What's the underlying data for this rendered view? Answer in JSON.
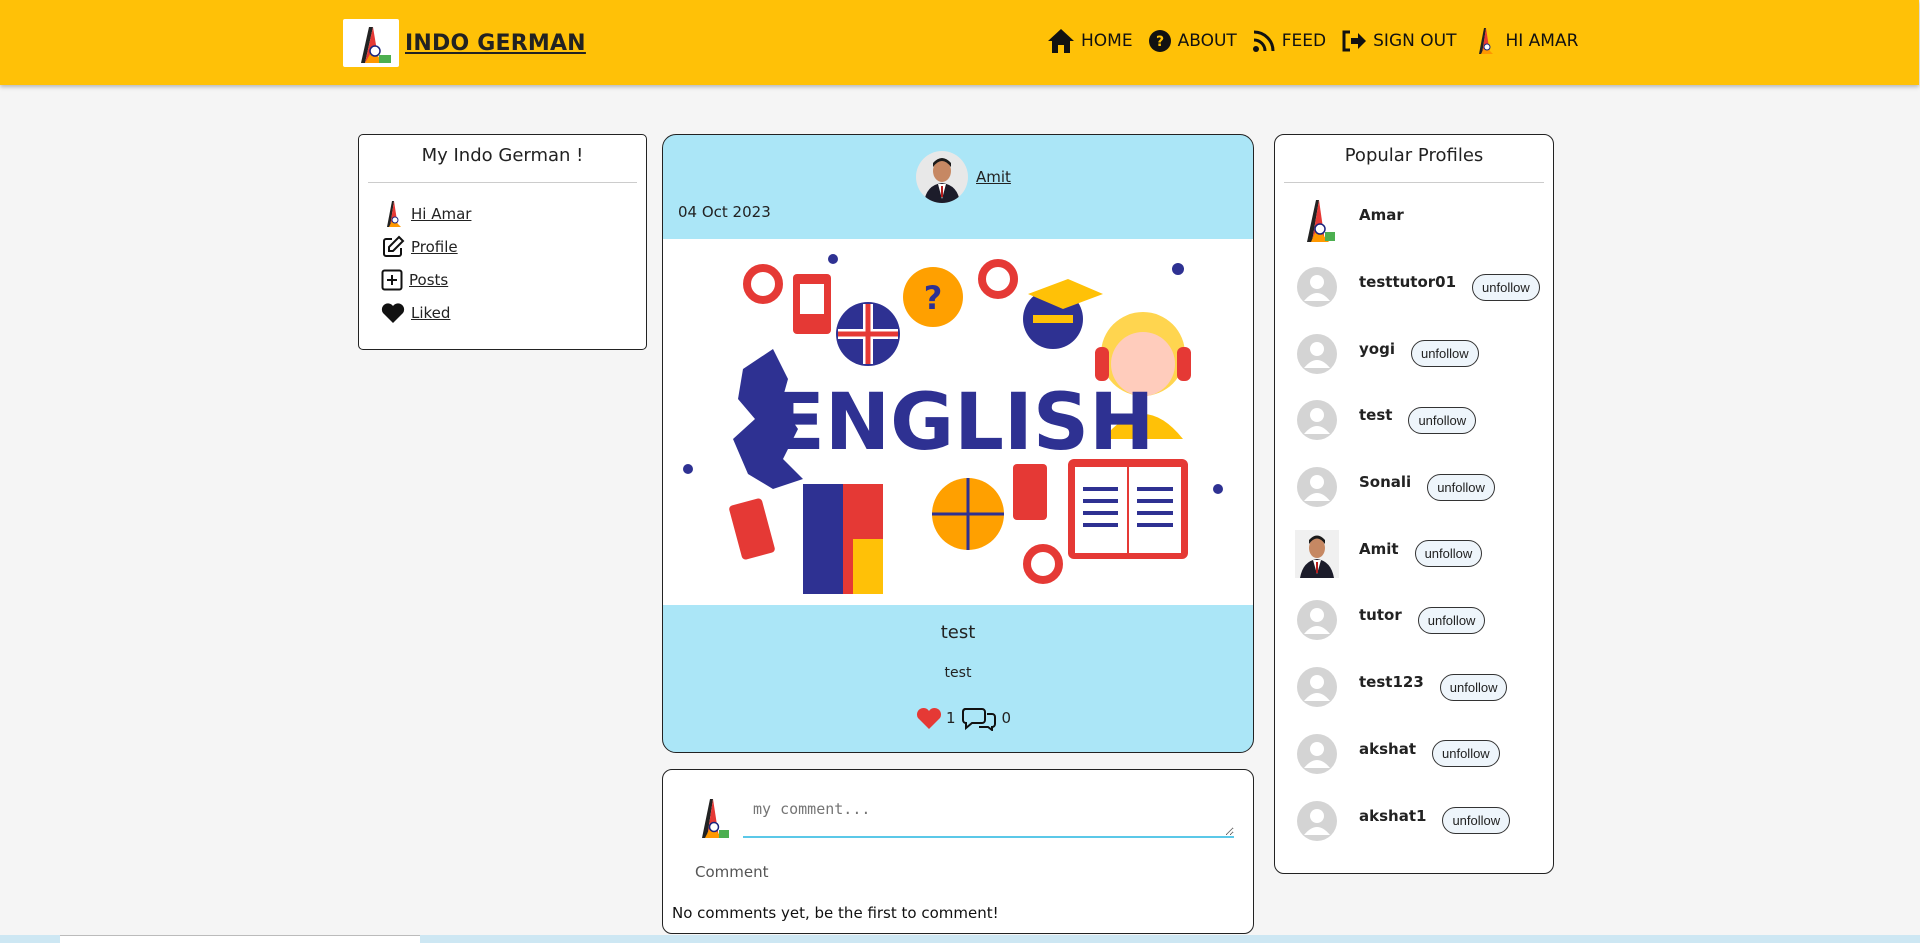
{
  "navbar": {
    "brand": "INDO GERMAN",
    "items": [
      {
        "label": "HOME",
        "icon": "home-icon"
      },
      {
        "label": "ABOUT",
        "icon": "question-icon"
      },
      {
        "label": "FEED",
        "icon": "rss-icon"
      },
      {
        "label": "SIGN OUT",
        "icon": "sign-out-icon"
      }
    ],
    "greeting": "HI AMAR",
    "bg_color": "#ffc107"
  },
  "left_card": {
    "title": "My Indo German !",
    "items": [
      {
        "label": "Hi Amar",
        "icon": "flag-logo-icon"
      },
      {
        "label": "Profile",
        "icon": "edit-icon"
      },
      {
        "label": "Posts",
        "icon": "plus-square-icon"
      },
      {
        "label": "Liked",
        "icon": "heart-icon"
      }
    ]
  },
  "post": {
    "author": "Amit",
    "date": "04 Oct 2023",
    "image_text": "ENGLISH",
    "title": "test",
    "body": "test",
    "likes": "1",
    "comments": "0",
    "bg_color": "#abe6f7"
  },
  "comment_box": {
    "placeholder": "my comment...",
    "label": "Comment",
    "empty_text": "No comments yet, be the first to comment!"
  },
  "popular": {
    "title": "Popular Profiles",
    "button_label": "unfollow",
    "profiles": [
      {
        "name": "Amar",
        "avatar": "flag",
        "follow": false
      },
      {
        "name": "testtutor01",
        "avatar": "default",
        "follow": true
      },
      {
        "name": "yogi",
        "avatar": "default",
        "follow": true
      },
      {
        "name": "test",
        "avatar": "default",
        "follow": true
      },
      {
        "name": "Sonali",
        "avatar": "default",
        "follow": true
      },
      {
        "name": "Amit",
        "avatar": "photo",
        "follow": true
      },
      {
        "name": "tutor",
        "avatar": "default",
        "follow": true
      },
      {
        "name": "test123",
        "avatar": "default",
        "follow": true
      },
      {
        "name": "akshat",
        "avatar": "default",
        "follow": true
      },
      {
        "name": "akshat1",
        "avatar": "default",
        "follow": true
      }
    ]
  }
}
